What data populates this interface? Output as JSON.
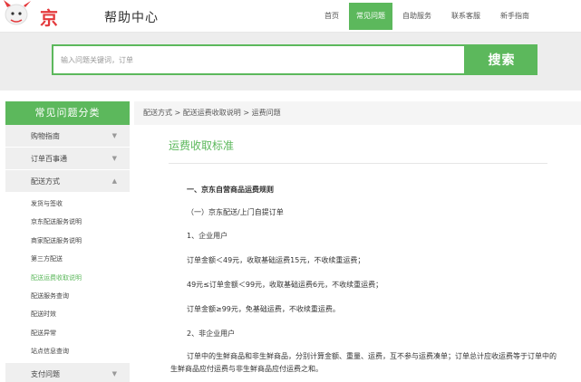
{
  "header": {
    "logo_text": "京东",
    "help_text": "帮助中心",
    "nav": [
      {
        "label": "首页",
        "active": false
      },
      {
        "label": "常见问题",
        "active": true
      },
      {
        "label": "自助服务",
        "active": false
      },
      {
        "label": "联系客服",
        "active": false
      },
      {
        "label": "新手指南",
        "active": false
      }
    ]
  },
  "search": {
    "placeholder": "输入问题关键词，订单",
    "button_label": "搜索"
  },
  "sidebar": {
    "title": "常见问题分类",
    "categories": [
      {
        "label": "购物指南",
        "expanded": false
      },
      {
        "label": "订单百事通",
        "expanded": false
      },
      {
        "label": "配送方式",
        "expanded": true
      }
    ],
    "sub_items": [
      "发货与签收",
      "京东配送服务说明",
      "商家配送服务说明",
      "第三方配送",
      "配送运费收取说明",
      "配送服务查询",
      "配送时效",
      "配送异常",
      "站点信息查询"
    ],
    "active_sub": "配送运费收取说明",
    "bottom_category": "支付问题"
  },
  "main": {
    "breadcrumb": "配送方式 > 配送运费收取说明 > 运费问题",
    "title": "运费收取标准",
    "paragraphs": {
      "p1": "一、京东自营商品运费规则",
      "p2": "（一）京东配送/上门自提订单",
      "p3": "1、企业用户",
      "p4": "订单金额＜49元，收取基础运费15元，不收续重运费；",
      "p5": "49元≤订单金额＜99元，收取基础运费6元，不收续重运费；",
      "p6": "订单金额≥99元，免基础运费，不收续重运费。",
      "p7": "2、非企业用户",
      "p8": "订单中的生鲜商品和非生鲜商品，分别计算金额、重量、运费，互不参与运费凑单；订单总计应收运费等于订单中的生鲜商品应付运费与非生鲜商品应付运费之和。"
    }
  },
  "colors": {
    "brand_red": "#e4393c",
    "accent_green": "#5cb85c"
  }
}
